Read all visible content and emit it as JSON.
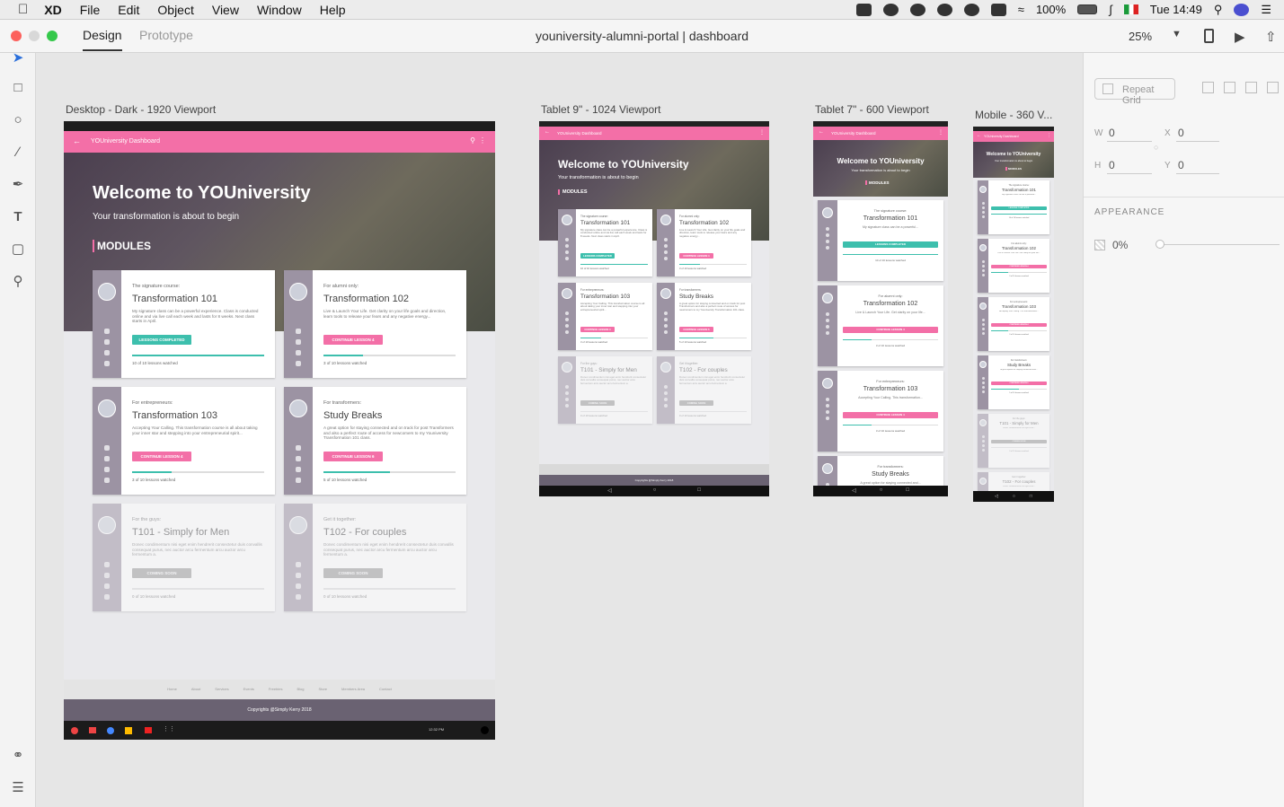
{
  "menubar": {
    "app": "XD",
    "items": [
      "File",
      "Edit",
      "Object",
      "View",
      "Window",
      "Help"
    ],
    "battery": "100%",
    "clock": "Tue 14:49"
  },
  "window": {
    "tabs": [
      "Design",
      "Prototype"
    ],
    "title": "youniversity-alumni-portal | dashboard",
    "zoom": "25%"
  },
  "inspector": {
    "repeat_grid": "Repeat Grid",
    "w_label": "W",
    "w": "0",
    "x_label": "X",
    "x": "0",
    "h_label": "H",
    "h": "0",
    "y_label": "Y",
    "y": "0",
    "appearance": "APPEARANCE",
    "opacity": "0%"
  },
  "artboards": {
    "desktop": {
      "label": "Desktop - Dark - 1920 Viewport",
      "app_title": "YOUniversity Dashboard",
      "hero_title": "Welcome to YOUniversity",
      "hero_sub": "Your transformation is about to begin",
      "modules": "MODULES",
      "footer_nav": [
        "Home",
        "About",
        "Services",
        "Events",
        "Freebies",
        "Blog",
        "Store",
        "Members Area",
        "Contact"
      ],
      "copyright": "Copyrights @Simply Kerry 2018",
      "time": "12:32 PM"
    },
    "tablet9": {
      "label": "Tablet 9\" - 1024 Viewport",
      "app_title": "YOUniversity Dashboard",
      "hero_title": "Welcome to YOUniversity",
      "hero_sub": "Your transformation is about to begin",
      "modules": "MODULES",
      "copyright": "Copyrights @Simply Kerry 2018"
    },
    "tablet7": {
      "label": "Tablet 7\" - 600 Viewport",
      "app_title": "YOUniversity Dashboard",
      "hero_title": "Welcome to YOUniversity",
      "hero_sub": "Your transformation is about to begin",
      "modules": "MODULES"
    },
    "mobile": {
      "label": "Mobile - 360 V...",
      "app_title": "YOUniversity Dashboard",
      "hero_title": "Welcome to YOUniversity",
      "hero_sub": "Your transformation is about to begin",
      "modules": "MODULES"
    }
  },
  "courses": [
    {
      "eyebrow": "The signature course:",
      "title": "Transformation 101",
      "desc": "My signature class can be a powerful experience. Class is conducted online and via live call each week and lasts for 8 weeks. Next class starts in April.",
      "short": "My signature class can be a powerful...",
      "button": "LESSONS COMPLETED",
      "progress_text": "10 of 10 lessons watched",
      "progress": 1.0,
      "color": "#3dbfad"
    },
    {
      "eyebrow": "For alumni only:",
      "title": "Transformation 102",
      "desc": "Live & Launch Your Life. Get clarity on your life goals and direction, learn tools to release your fears and any negative energy...",
      "short": "Live & Launch Your Life. Get clarity on your life...",
      "button": "CONTINUE LESSON 4",
      "progress_text": "3 of 10 lessons watched",
      "progress": 0.3,
      "color": "#f36fa7"
    },
    {
      "eyebrow": "For entrepreneurs:",
      "title": "Transformation 103",
      "desc": "Accepting Your Calling. This transformation course is all about taking your inner star and stepping into your entrepreneurial spirit...",
      "short": "Accepting Your Calling. This transformation...",
      "button": "CONTINUE LESSON 4",
      "progress_text": "3 of 10 lessons watched",
      "progress": 0.3,
      "color": "#f36fa7"
    },
    {
      "eyebrow": "For transformers:",
      "title": "Study Breaks",
      "desc": "A great option for staying connected and on track for post Transformers and also a perfect route of access for newcomers to my Youniversity Transformation 101 class.",
      "short": "A great option for staying connected and...",
      "button": "CONTINUE LESSON 6",
      "progress_text": "5 of 10 lessons watched",
      "progress": 0.5,
      "color": "#f36fa7"
    },
    {
      "eyebrow": "For the guys:",
      "title": "T101 - Simply for Men",
      "desc": "Donec condimentum nisi eget enim hendrerit consectetur duis convallis consequat purus, nec auctor arcu fermentum arcu auctor arcu fermentum a.",
      "short": "Donec condimentum nisi eget enim...",
      "button": "COMING SOON",
      "progress_text": "0 of 10 lessons watched",
      "progress": 0.0,
      "color": "#9a9a9a",
      "dim": true
    },
    {
      "eyebrow": "Get it together:",
      "title": "T102 - For couples",
      "desc": "Donec condimentum nisi eget enim hendrerit consectetur duis convallis consequat purus, nec auctor arcu fermentum arcu auctor arcu fermentum a.",
      "short": "Donec condimentum nisi eget enim...",
      "button": "COMING SOON",
      "progress_text": "0 of 10 lessons watched",
      "progress": 0.0,
      "color": "#9a9a9a",
      "dim": true
    }
  ],
  "icons": {
    "apple": "apple-icon",
    "select": "select-arrow-icon",
    "rectangle": "rectangle-tool-icon",
    "ellipse": "ellipse-tool-icon",
    "line": "line-tool-icon",
    "pen": "pen-tool-icon",
    "text": "text-tool-icon",
    "artboard": "artboard-tool-icon",
    "zoom": "zoom-tool-icon",
    "assets": "assets-icon",
    "layers": "layers-icon",
    "play": "play-icon",
    "share": "share-icon",
    "device": "device-preview-icon"
  },
  "colors": {
    "accent": "#f36fa7",
    "teal": "#3dbfad",
    "strip": "#9c93a3"
  }
}
